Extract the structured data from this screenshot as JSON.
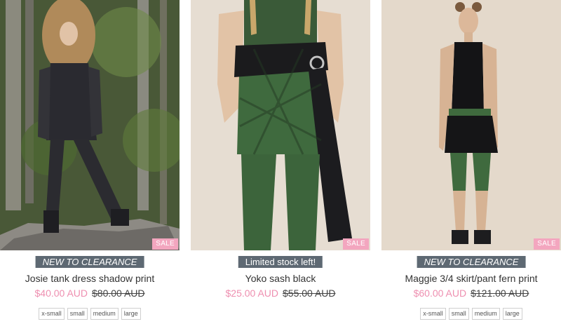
{
  "products": [
    {
      "image": "forest-model-photo",
      "sale_badge": "SALE",
      "tag": "NEW TO CLEARANCE",
      "tag_style": "italic",
      "title": "Josie tank dress shadow print",
      "price": "$40.00 AUD",
      "old_price": "$80.00 AUD",
      "sizes": [
        "x-small",
        "small",
        "medium",
        "large"
      ]
    },
    {
      "image": "sash-closeup-photo",
      "sale_badge": "SALE",
      "tag": "Limited stock left!",
      "tag_style": "normal",
      "title": "Yoko sash black",
      "price": "$25.00 AUD",
      "old_price": "$55.00 AUD",
      "sizes": []
    },
    {
      "image": "studio-model-photo",
      "sale_badge": "SALE",
      "tag": "NEW TO CLEARANCE",
      "tag_style": "italic",
      "title": "Maggie 3/4 skirt/pant fern print",
      "price": "$60.00 AUD",
      "old_price": "$121.00 AUD",
      "sizes": [
        "x-small",
        "small",
        "medium",
        "large"
      ]
    }
  ],
  "colors": {
    "sale_badge": "#f3a6bf",
    "tag_bg": "#5e6973",
    "sale_price": "#ee8fb0"
  }
}
